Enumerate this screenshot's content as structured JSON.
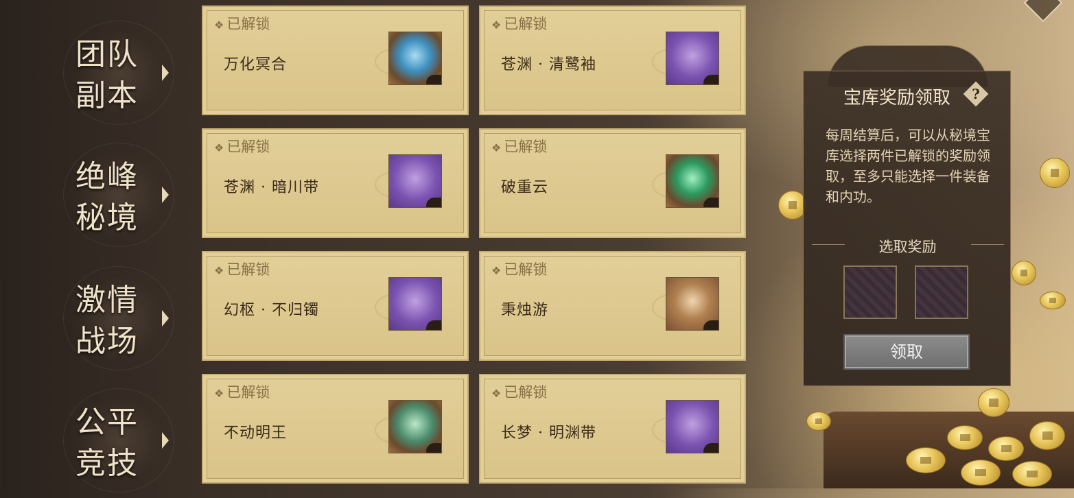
{
  "categories": [
    {
      "line1": "团队",
      "line2": "副本"
    },
    {
      "line1": "绝峰",
      "line2": "秘境"
    },
    {
      "line1": "激情",
      "line2": "战场"
    },
    {
      "line1": "公平",
      "line2": "竞技"
    }
  ],
  "rewards": [
    {
      "status": "已解锁",
      "name": "万化冥合",
      "icon": "blue-orb-icon"
    },
    {
      "status": "已解锁",
      "name": "苍渊 · 清鹭袖",
      "icon": "bracer-icon"
    },
    {
      "status": "已解锁",
      "name": "苍渊 · 暗川带",
      "icon": "belt-icon"
    },
    {
      "status": "已解锁",
      "name": "破重云",
      "icon": "green-crystal-icon"
    },
    {
      "status": "已解锁",
      "name": "幻枢 · 不归镯",
      "icon": "bracelet-icon"
    },
    {
      "status": "已解锁",
      "name": "秉烛游",
      "icon": "scroll-icon"
    },
    {
      "status": "已解锁",
      "name": "不动明王",
      "icon": "jade-stone-icon"
    },
    {
      "status": "已解锁",
      "name": "长梦 · 明渊带",
      "icon": "belt-icon"
    }
  ],
  "panel": {
    "title": "宝库奖励领取",
    "help": "?",
    "description": "每周结算后，可以从秘境宝库选择两件已解锁的奖励领取，至多只能选择一件装备和内功。",
    "select_label": "选取奖励",
    "claim_label": "领取"
  },
  "status_marker": "❖"
}
